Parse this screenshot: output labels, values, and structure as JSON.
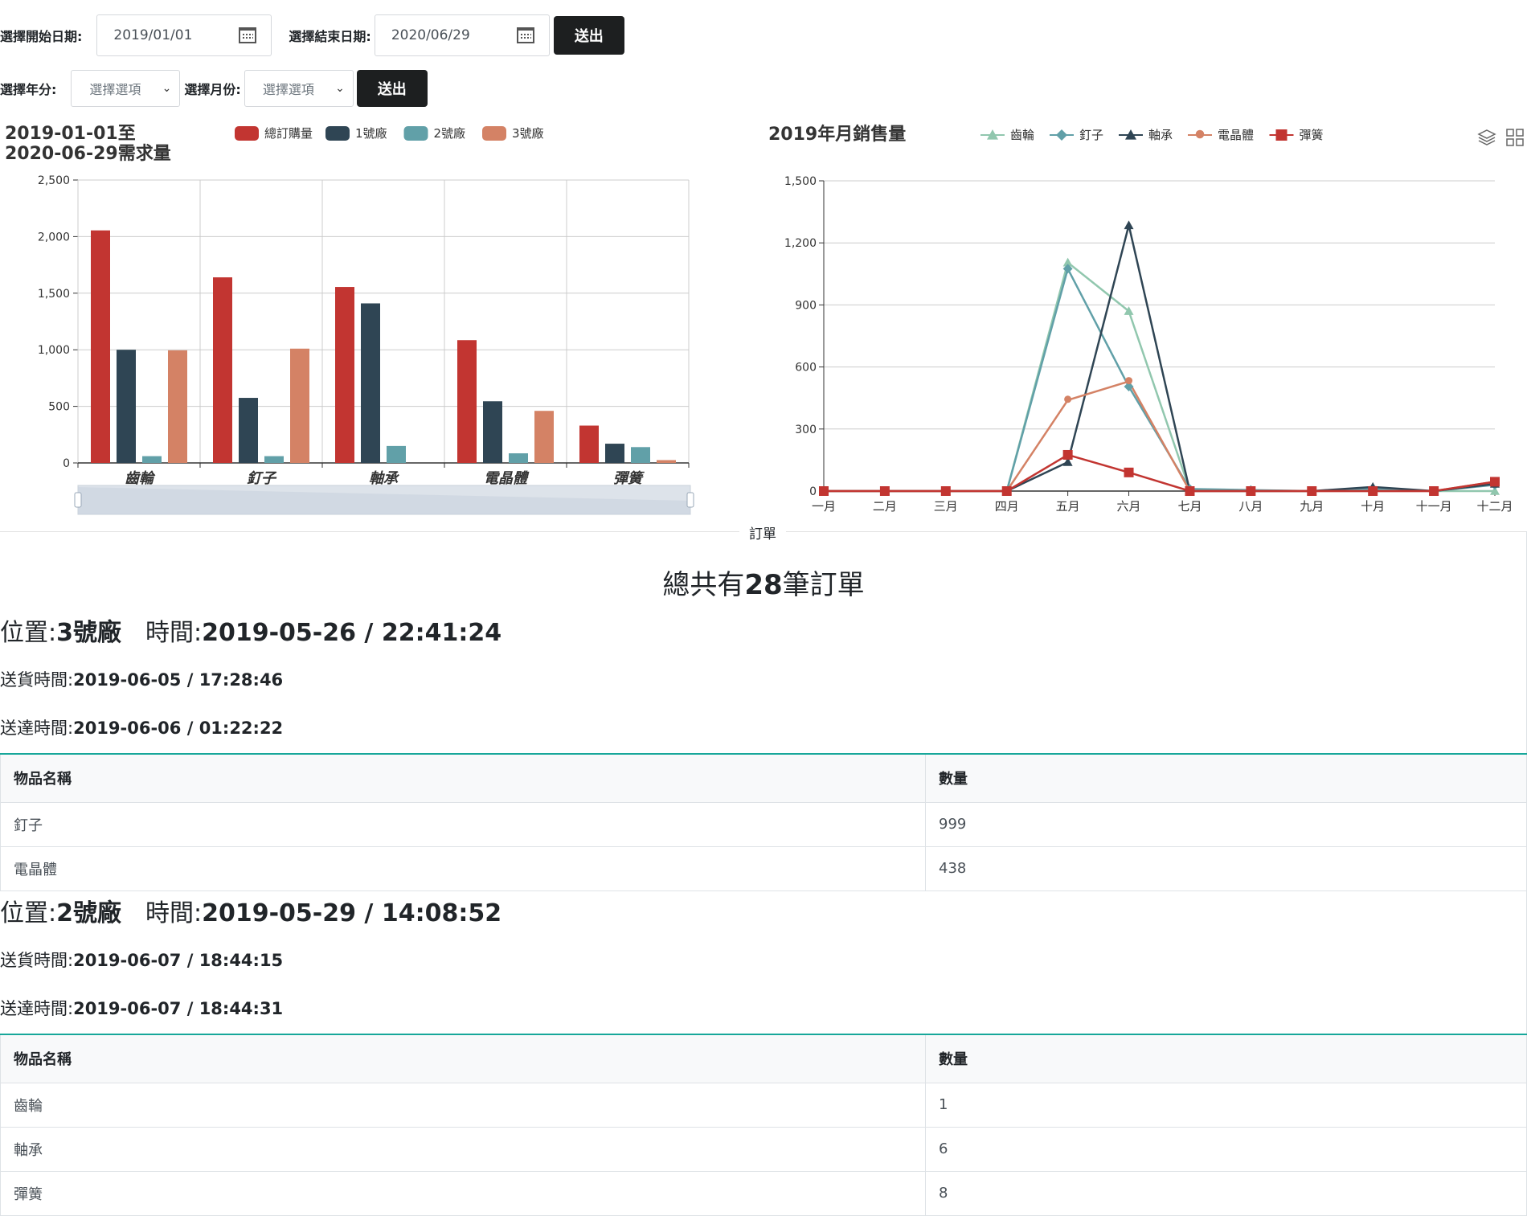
{
  "filters": {
    "start_label": "選擇開始日期:",
    "start_value": "2019/01/01",
    "end_label": "選擇結束日期:",
    "end_value": "2020/06/29",
    "submit_label": "送出",
    "year_label": "選擇年分:",
    "year_value": "選擇選項",
    "month_label": "選擇月份:",
    "month_value": "選擇選項",
    "submit2_label": "送出"
  },
  "chart_data": [
    {
      "type": "bar",
      "title": "2019-01-01至\n2020-06-29需求量",
      "title_line1": "2019-01-01至",
      "title_line2": "2020-06-29需求量",
      "categories": [
        "齒輪",
        "釘子",
        "軸承",
        "電晶體",
        "彈簧"
      ],
      "series": [
        {
          "name": "總訂購量",
          "color": "#c23531",
          "values": [
            2055,
            1640,
            1555,
            1085,
            330
          ]
        },
        {
          "name": "1號廠",
          "color": "#2f4554",
          "values": [
            1000,
            575,
            1410,
            545,
            170
          ]
        },
        {
          "name": "2號廠",
          "color": "#61a0a8",
          "values": [
            60,
            60,
            150,
            85,
            140
          ]
        },
        {
          "name": "3號廠",
          "color": "#d48265",
          "values": [
            995,
            1010,
            0,
            460,
            25
          ]
        }
      ],
      "ylim": [
        0,
        2500
      ],
      "yticks": [
        "2,500",
        "2,000",
        "1,500",
        "1,000",
        "500",
        "0"
      ],
      "grid": true,
      "legend": "top"
    },
    {
      "type": "line",
      "title": "2019年月銷售量",
      "categories": [
        "一月",
        "二月",
        "三月",
        "四月",
        "五月",
        "六月",
        "七月",
        "八月",
        "九月",
        "十月",
        "十一月",
        "十二月"
      ],
      "series": [
        {
          "name": "齒輪",
          "color": "#91c7ae",
          "symbol": "triangle",
          "values": [
            0,
            0,
            0,
            0,
            1105,
            870,
            5,
            3,
            0,
            10,
            0,
            0
          ]
        },
        {
          "name": "釘子",
          "color": "#61a0a8",
          "symbol": "diamond",
          "values": [
            0,
            0,
            0,
            0,
            1075,
            505,
            10,
            5,
            0,
            10,
            0,
            30
          ]
        },
        {
          "name": "軸承",
          "color": "#2f4554",
          "symbol": "triangle",
          "values": [
            0,
            0,
            0,
            0,
            140,
            1285,
            0,
            0,
            0,
            20,
            0,
            35
          ]
        },
        {
          "name": "電晶體",
          "color": "#d48265",
          "symbol": "pin",
          "values": [
            0,
            0,
            0,
            0,
            440,
            530,
            0,
            0,
            0,
            0,
            0,
            45
          ]
        },
        {
          "name": "彈簧",
          "color": "#c23531",
          "symbol": "rect",
          "values": [
            0,
            0,
            0,
            0,
            175,
            90,
            0,
            0,
            0,
            0,
            0,
            45
          ]
        }
      ],
      "ylim": [
        0,
        1500
      ],
      "yticks": [
        "1,500",
        "1,200",
        "900",
        "600",
        "300",
        "0"
      ],
      "grid": true,
      "legend": "top"
    }
  ],
  "orders_section": {
    "tab_label": "訂單",
    "total_prefix": "總共有",
    "total_count": "28",
    "total_suffix": "筆訂單",
    "location_label": "位置:",
    "time_label": "時間:",
    "ship_label": "送貨時間:",
    "arrive_label": "送達時間:",
    "col_item": "物品名稱",
    "col_qty": "數量",
    "orders": [
      {
        "location": "3號廠",
        "time": "2019-05-26 / 22:41:24",
        "ship_time": "2019-06-05 / 17:28:46",
        "arrive_time": "2019-06-06 / 01:22:22",
        "items": [
          {
            "name": "釘子",
            "qty": "999"
          },
          {
            "name": "電晶體",
            "qty": "438"
          }
        ]
      },
      {
        "location": "2號廠",
        "time": "2019-05-29 / 14:08:52",
        "ship_time": "2019-06-07 / 18:44:15",
        "arrive_time": "2019-06-07 / 18:44:31",
        "items": [
          {
            "name": "齒輪",
            "qty": "1"
          },
          {
            "name": "軸承",
            "qty": "6"
          },
          {
            "name": "彈簧",
            "qty": "8"
          }
        ]
      }
    ]
  }
}
